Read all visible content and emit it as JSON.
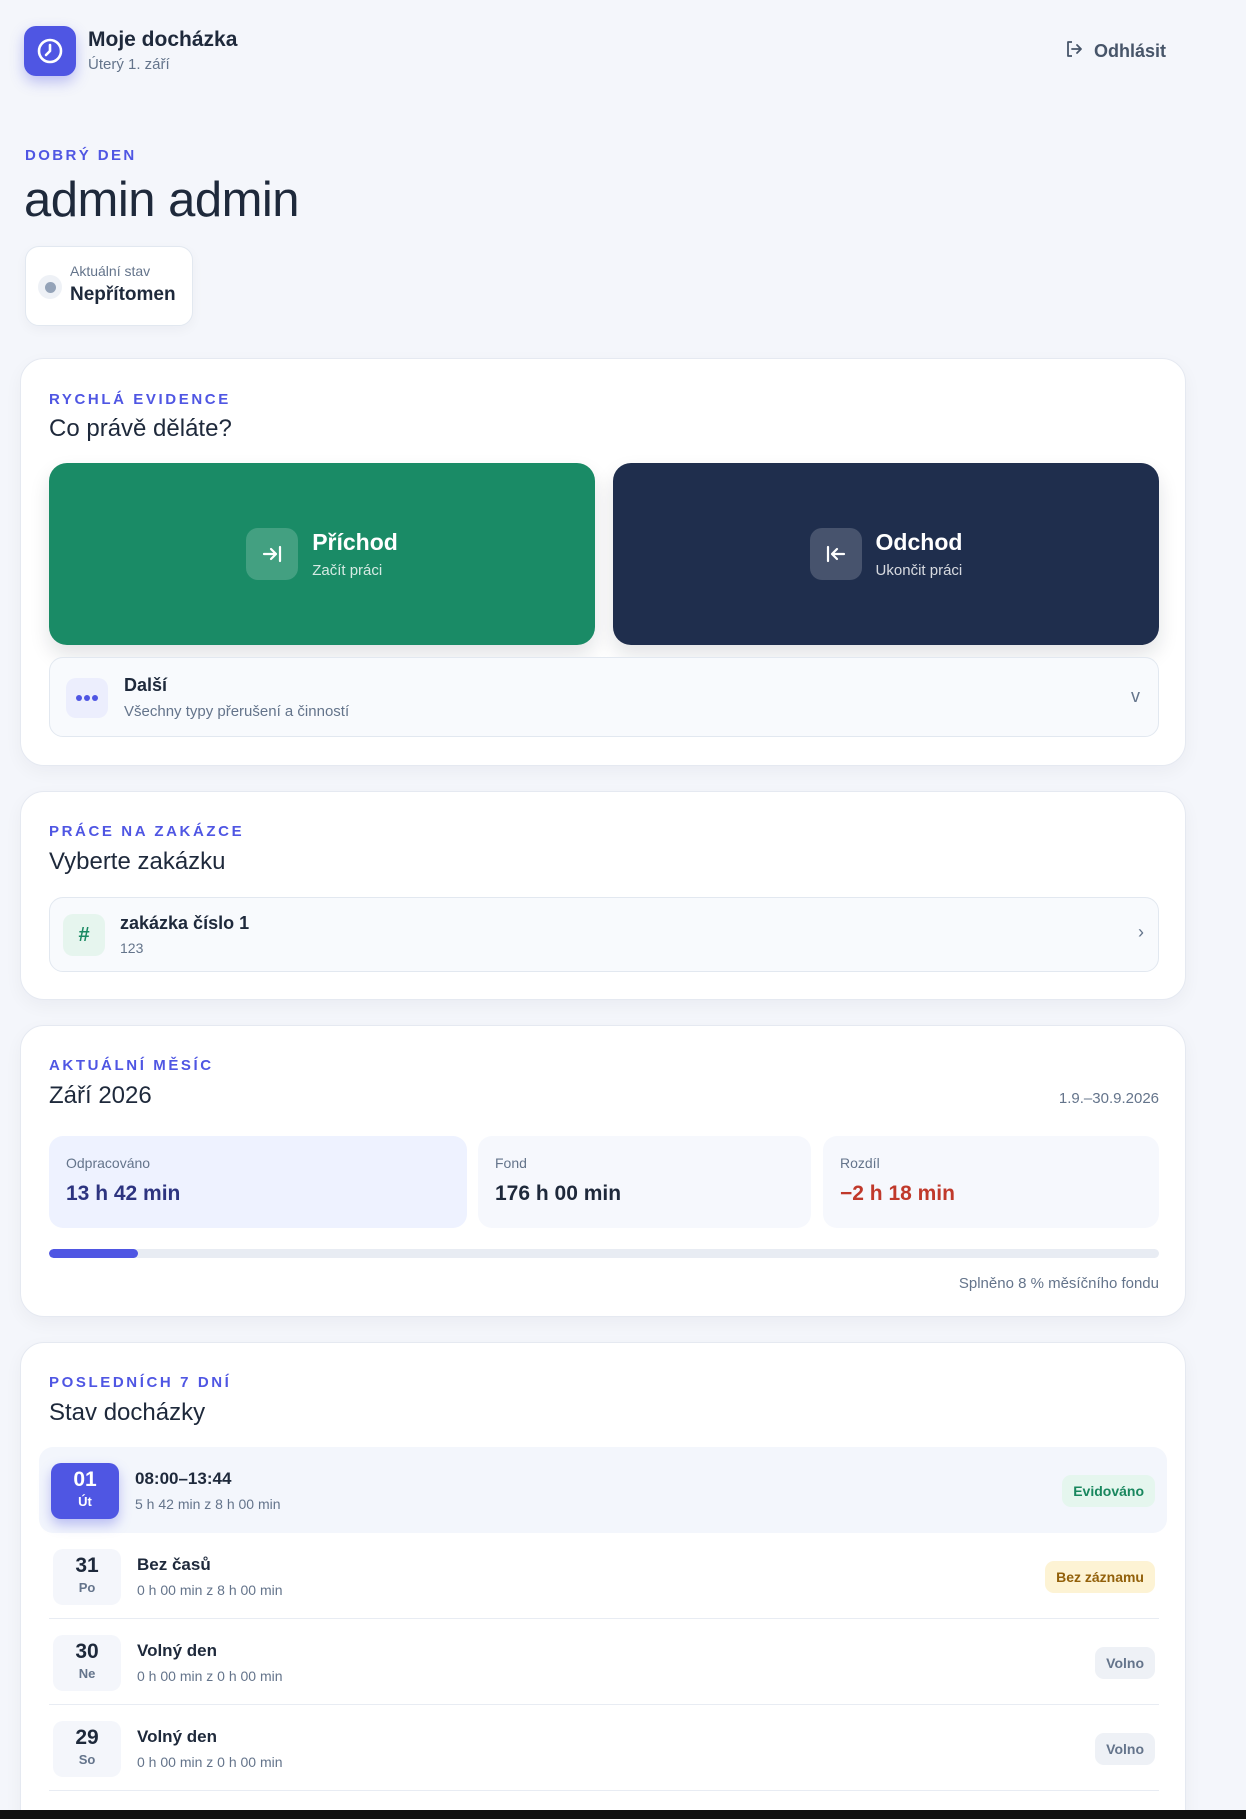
{
  "header": {
    "app_title": "Moje docházka",
    "date": "Úterý 1. září",
    "logout_label": "Odhlásit"
  },
  "greeting": {
    "eyebrow": "DOBRÝ DEN",
    "name": "admin admin"
  },
  "status": {
    "label": "Aktuální stav",
    "value": "Nepřítomen"
  },
  "quick": {
    "eyebrow": "RYCHLÁ EVIDENCE",
    "title": "Co právě děláte?",
    "arrival": {
      "title": "Příchod",
      "subtitle": "Začít práci"
    },
    "departure": {
      "title": "Odchod",
      "subtitle": "Ukončit práci"
    },
    "more": {
      "title": "Další",
      "subtitle": "Všechny typy přerušení a činností",
      "chevron": "v"
    }
  },
  "orders": {
    "eyebrow": "PRÁCE NA ZAKÁZCE",
    "title": "Vyberte zakázku",
    "items": [
      {
        "icon_glyph": "#",
        "name": "zakázka číslo 1",
        "code": "123",
        "chevron": "›"
      }
    ]
  },
  "month": {
    "eyebrow": "AKTUÁLNÍ MĚSÍC",
    "title": "Září 2026",
    "period": "1.9.–30.9.2026",
    "worked": {
      "label": "Odpracováno",
      "value": "13 h 42 min"
    },
    "fund": {
      "label": "Fond",
      "value": "176 h 00 min"
    },
    "diff": {
      "label": "Rozdíl",
      "value": "−2 h 18 min"
    },
    "progress_percent": 8,
    "progress_label": "Splněno 8 % měsíčního fondu"
  },
  "last7": {
    "eyebrow": "POSLEDNÍCH 7 DNÍ",
    "title": "Stav docházky",
    "days": [
      {
        "num": "01",
        "dow": "Út",
        "title": "08:00–13:44",
        "sub": "5 h 42 min z 8 h 00 min",
        "tag": "Evidováno"
      },
      {
        "num": "31",
        "dow": "Po",
        "title": "Bez časů",
        "sub": "0 h 00 min z 8 h 00 min",
        "tag": "Bez záznamu"
      },
      {
        "num": "30",
        "dow": "Ne",
        "title": "Volný den",
        "sub": "0 h 00 min z 0 h 00 min",
        "tag": "Volno"
      },
      {
        "num": "29",
        "dow": "So",
        "title": "Volný den",
        "sub": "0 h 00 min z 0 h 00 min",
        "tag": "Volno"
      }
    ]
  },
  "colors": {
    "accent": "#4f56e3",
    "arrival_bg": "#1a8b66",
    "departure_bg": "#1f2e4d",
    "negative": "#c0392b"
  },
  "icons": {
    "logo": "clock-icon",
    "logout": "logout-icon",
    "arrival": "arrow-to-right-icon",
    "departure": "arrow-to-left-icon",
    "more": "dots-icon"
  }
}
